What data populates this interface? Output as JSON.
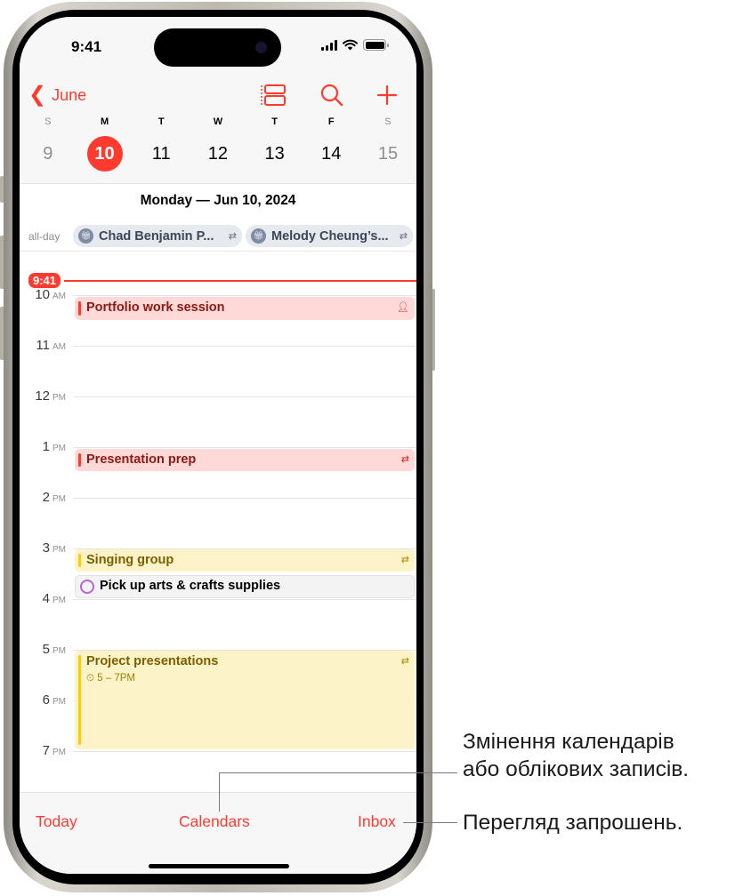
{
  "status_bar": {
    "time": "9:41"
  },
  "nav": {
    "back_label": "June",
    "icons": [
      "list-view-icon",
      "search-icon",
      "add-icon"
    ]
  },
  "week": [
    {
      "letter": "S",
      "num": "9",
      "weekend": true,
      "selected": false
    },
    {
      "letter": "M",
      "num": "10",
      "weekend": false,
      "selected": true
    },
    {
      "letter": "T",
      "num": "11",
      "weekend": false,
      "selected": false
    },
    {
      "letter": "W",
      "num": "12",
      "weekend": false,
      "selected": false
    },
    {
      "letter": "T",
      "num": "13",
      "weekend": false,
      "selected": false
    },
    {
      "letter": "F",
      "num": "14",
      "weekend": false,
      "selected": false
    },
    {
      "letter": "S",
      "num": "15",
      "weekend": true,
      "selected": false
    }
  ],
  "day_title": "Monday — Jun 10, 2024",
  "all_day": {
    "label": "all-day",
    "events": [
      {
        "title": "Chad Benjamin P...",
        "icon": "gift-icon",
        "repeat": true
      },
      {
        "title": "Melody Cheung’s...",
        "icon": "gift-icon",
        "repeat": true
      }
    ]
  },
  "now_time": "9:41",
  "hours": [
    {
      "num": "10",
      "ampm": "AM"
    },
    {
      "num": "11",
      "ampm": "AM"
    },
    {
      "num": "12",
      "ampm": "PM"
    },
    {
      "num": "1",
      "ampm": "PM"
    },
    {
      "num": "2",
      "ampm": "PM"
    },
    {
      "num": "3",
      "ampm": "PM"
    },
    {
      "num": "4",
      "ampm": "PM"
    },
    {
      "num": "5",
      "ampm": "PM"
    },
    {
      "num": "6",
      "ampm": "PM"
    },
    {
      "num": "7",
      "ampm": "PM"
    }
  ],
  "events": [
    {
      "title": "Portfolio work session",
      "color": "red",
      "icon": "invitee-icon"
    },
    {
      "title": "Presentation prep",
      "color": "red",
      "icon": "repeat-icon"
    },
    {
      "title": "Singing group",
      "color": "yellow",
      "icon": "repeat-icon"
    },
    {
      "title": "Project presentations",
      "color": "yellow",
      "icon": "repeat-icon",
      "time": "5 – 7PM"
    }
  ],
  "reminder": {
    "title": "Pick up arts & crafts supplies"
  },
  "toolbar": {
    "today": "Today",
    "calendars": "Calendars",
    "inbox": "Inbox"
  },
  "callouts": {
    "calendars_line1": "Змінення календарів",
    "calendars_line2": "або облікових записів.",
    "inbox": "Перегляд запрошень."
  },
  "colors": {
    "accent": "#ff3b30",
    "event_red_bg": "#ffd9d7",
    "event_yellow_bg": "#fdf3c9",
    "event_yellow_bar": "#ffcc00",
    "reminder_ring": "#b564d6"
  }
}
